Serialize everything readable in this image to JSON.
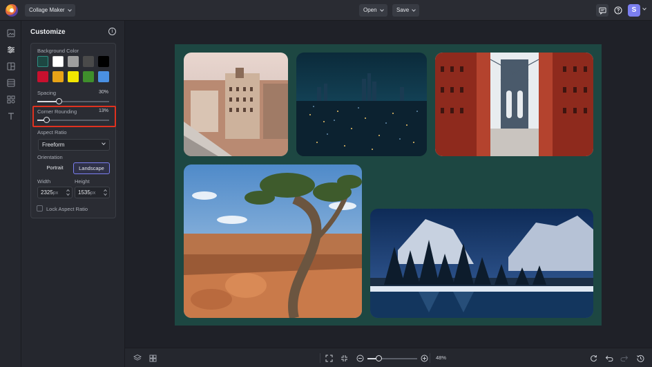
{
  "app": {
    "project_label": "Collage Maker",
    "open_label": "Open",
    "save_label": "Save",
    "user_initial": "S"
  },
  "panel": {
    "title": "Customize",
    "background_color_label": "Background Color",
    "swatches": [
      "#1d4742",
      "#ffffff",
      "#9e9e9e",
      "#4a4a4a",
      "#000000",
      "#c8102e",
      "#e8a317",
      "#f2e600",
      "#3f8f2c",
      "#4a90e2"
    ],
    "spacing_label": "Spacing",
    "spacing_value": "30%",
    "spacing_fraction": 0.3,
    "corner_rounding_label": "Corner Rounding",
    "corner_rounding_value": "13%",
    "corner_rounding_fraction": 0.13,
    "aspect_ratio_label": "Aspect Ratio",
    "aspect_ratio_value": "Freeform",
    "orientation_label": "Orientation",
    "portrait_label": "Portrait",
    "landscape_label": "Landscape",
    "width_label": "Width",
    "width_value": "2325",
    "height_label": "Height",
    "height_value": "1535",
    "unit": "px",
    "lock_label": "Lock Aspect Ratio"
  },
  "colors": {
    "collage_background": "#1d4742",
    "highlight": "#e0321f",
    "accent": "#7b7ff0"
  },
  "zoom": {
    "value": "48%",
    "fraction": 0.48
  }
}
